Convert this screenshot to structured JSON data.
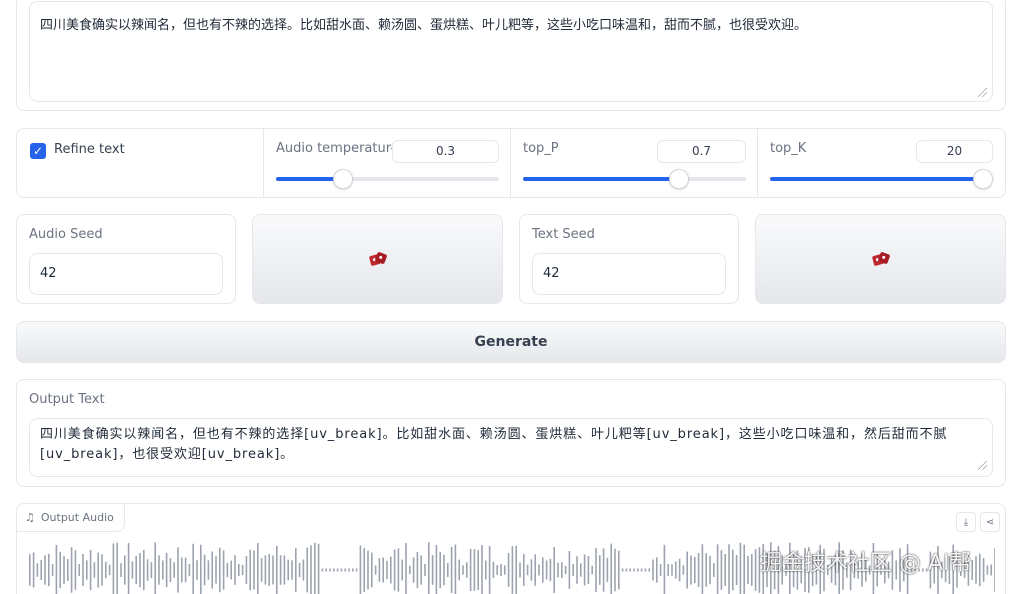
{
  "input": {
    "text": "四川美食确实以辣闻名，但也有不辣的选择。比如甜水面、赖汤圆、蛋烘糕、叶儿粑等，这些小吃口味温和，甜而不腻，也很受欢迎。"
  },
  "settings": {
    "refine_text": {
      "label": "Refine text",
      "checked": true
    },
    "audio_temperature": {
      "label": "Audio temperature",
      "value": "0.3",
      "fraction": 0.3
    },
    "top_p": {
      "label": "top_P",
      "value": "0.7",
      "fraction": 0.7
    },
    "top_k": {
      "label": "top_K",
      "value": "20",
      "fraction": 1.0
    }
  },
  "seeds": {
    "audio_seed": {
      "label": "Audio Seed",
      "value": "42"
    },
    "text_seed": {
      "label": "Text Seed",
      "value": "42"
    },
    "dice_icon": "dice-icon"
  },
  "generate": {
    "label": "Generate"
  },
  "output": {
    "label": "Output Text",
    "text": "四川美食确实以辣闻名，但也有不辣的选择[uv_break]。比如甜水面、赖汤圆、蛋烘糕、叶儿粑等[uv_break]，这些小吃口味温和，然后甜而不腻[uv_break]，也很受欢迎[uv_break]。"
  },
  "audio": {
    "label": "Output Audio",
    "icons": [
      "music-note-icon",
      "download-icon",
      "share-icon"
    ],
    "waveform_color": "#9ca3af"
  },
  "watermark": "掘金技术社区 @ AI帮",
  "colors": {
    "accent": "#2563eb",
    "border": "#e5e7eb",
    "dice": "#c0262d"
  }
}
